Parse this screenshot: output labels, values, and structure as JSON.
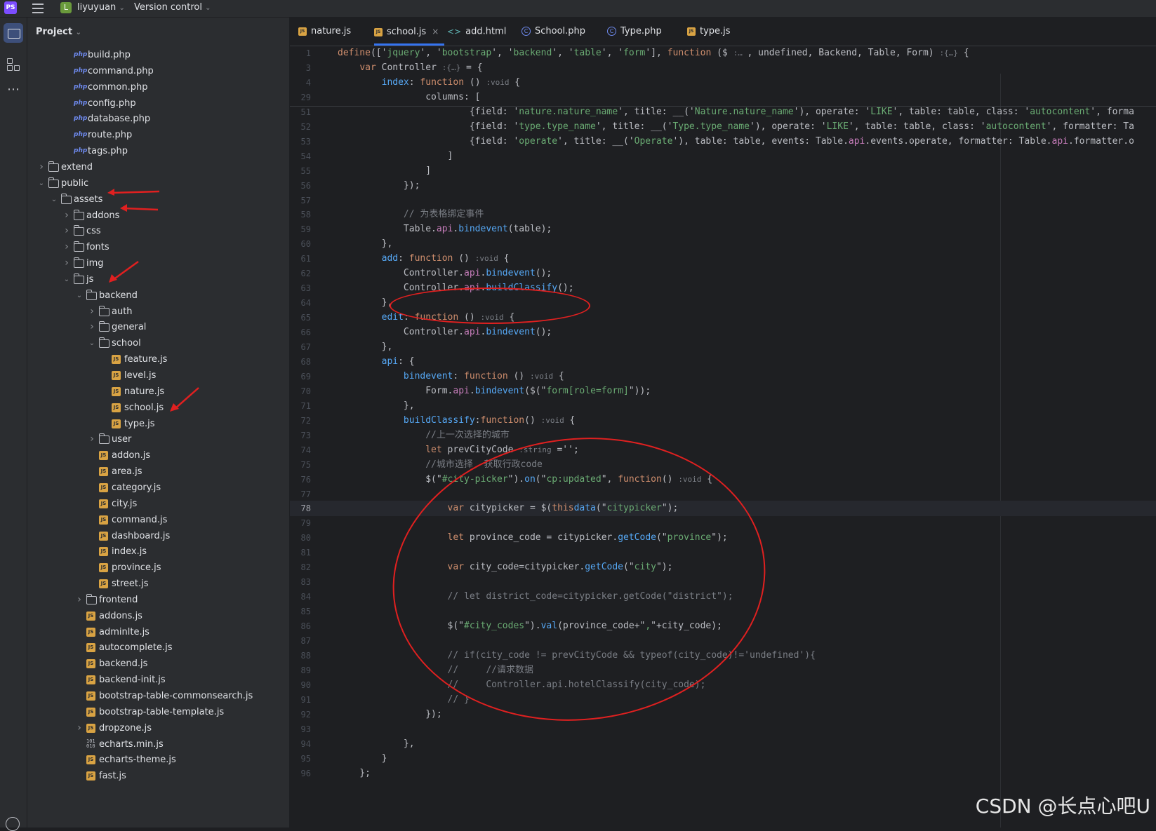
{
  "titlebar": {
    "app_icon": "PS",
    "project_badge": "L",
    "project_name": "liyuyuan",
    "version_control": "Version control"
  },
  "project_panel": {
    "title": "Project"
  },
  "tree": [
    {
      "label": "build.php",
      "type": "php",
      "depth": 3,
      "arrow": ""
    },
    {
      "label": "command.php",
      "type": "php",
      "depth": 3,
      "arrow": ""
    },
    {
      "label": "common.php",
      "type": "php",
      "depth": 3,
      "arrow": ""
    },
    {
      "label": "config.php",
      "type": "php",
      "depth": 3,
      "arrow": ""
    },
    {
      "label": "database.php",
      "type": "php",
      "depth": 3,
      "arrow": ""
    },
    {
      "label": "route.php",
      "type": "php",
      "depth": 3,
      "arrow": ""
    },
    {
      "label": "tags.php",
      "type": "php",
      "depth": 3,
      "arrow": ""
    },
    {
      "label": "extend",
      "type": "folder",
      "depth": 1,
      "arrow": "collapsed"
    },
    {
      "label": "public",
      "type": "folder",
      "depth": 1,
      "arrow": "expanded"
    },
    {
      "label": "assets",
      "type": "folder",
      "depth": 2,
      "arrow": "expanded"
    },
    {
      "label": "addons",
      "type": "folder",
      "depth": 3,
      "arrow": "collapsed"
    },
    {
      "label": "css",
      "type": "folder",
      "depth": 3,
      "arrow": "collapsed"
    },
    {
      "label": "fonts",
      "type": "folder",
      "depth": 3,
      "arrow": "collapsed"
    },
    {
      "label": "img",
      "type": "folder",
      "depth": 3,
      "arrow": "collapsed"
    },
    {
      "label": "js",
      "type": "folder",
      "depth": 3,
      "arrow": "expanded"
    },
    {
      "label": "backend",
      "type": "folder",
      "depth": 4,
      "arrow": "expanded"
    },
    {
      "label": "auth",
      "type": "folder",
      "depth": 5,
      "arrow": "collapsed"
    },
    {
      "label": "general",
      "type": "folder",
      "depth": 5,
      "arrow": "collapsed"
    },
    {
      "label": "school",
      "type": "folder",
      "depth": 5,
      "arrow": "expanded"
    },
    {
      "label": "feature.js",
      "type": "js",
      "depth": 6,
      "arrow": ""
    },
    {
      "label": "level.js",
      "type": "js",
      "depth": 6,
      "arrow": ""
    },
    {
      "label": "nature.js",
      "type": "js",
      "depth": 6,
      "arrow": ""
    },
    {
      "label": "school.js",
      "type": "js",
      "depth": 6,
      "arrow": ""
    },
    {
      "label": "type.js",
      "type": "js",
      "depth": 6,
      "arrow": ""
    },
    {
      "label": "user",
      "type": "folder",
      "depth": 5,
      "arrow": "collapsed"
    },
    {
      "label": "addon.js",
      "type": "js",
      "depth": 5,
      "arrow": ""
    },
    {
      "label": "area.js",
      "type": "js",
      "depth": 5,
      "arrow": ""
    },
    {
      "label": "category.js",
      "type": "js",
      "depth": 5,
      "arrow": ""
    },
    {
      "label": "city.js",
      "type": "js",
      "depth": 5,
      "arrow": ""
    },
    {
      "label": "command.js",
      "type": "js",
      "depth": 5,
      "arrow": ""
    },
    {
      "label": "dashboard.js",
      "type": "js",
      "depth": 5,
      "arrow": ""
    },
    {
      "label": "index.js",
      "type": "js",
      "depth": 5,
      "arrow": ""
    },
    {
      "label": "province.js",
      "type": "js",
      "depth": 5,
      "arrow": ""
    },
    {
      "label": "street.js",
      "type": "js",
      "depth": 5,
      "arrow": ""
    },
    {
      "label": "frontend",
      "type": "folder",
      "depth": 4,
      "arrow": "collapsed"
    },
    {
      "label": "addons.js",
      "type": "js",
      "depth": 4,
      "arrow": ""
    },
    {
      "label": "adminlte.js",
      "type": "js",
      "depth": 4,
      "arrow": ""
    },
    {
      "label": "autocomplete.js",
      "type": "js",
      "depth": 4,
      "arrow": ""
    },
    {
      "label": "backend.js",
      "type": "js",
      "depth": 4,
      "arrow": ""
    },
    {
      "label": "backend-init.js",
      "type": "js",
      "depth": 4,
      "arrow": ""
    },
    {
      "label": "bootstrap-table-commonsearch.js",
      "type": "js",
      "depth": 4,
      "arrow": ""
    },
    {
      "label": "bootstrap-table-template.js",
      "type": "js",
      "depth": 4,
      "arrow": ""
    },
    {
      "label": "dropzone.js",
      "type": "js",
      "depth": 4,
      "arrow": "collapsed"
    },
    {
      "label": "echarts.min.js",
      "type": "bin",
      "depth": 4,
      "arrow": ""
    },
    {
      "label": "echarts-theme.js",
      "type": "js",
      "depth": 4,
      "arrow": ""
    },
    {
      "label": "fast.js",
      "type": "js",
      "depth": 4,
      "arrow": ""
    }
  ],
  "tabs": [
    {
      "label": "nature.js",
      "icon": "js",
      "active": false,
      "closable": false
    },
    {
      "label": "school.js",
      "icon": "js",
      "active": true,
      "closable": true
    },
    {
      "label": "add.html",
      "icon": "html",
      "active": false,
      "closable": false
    },
    {
      "label": "School.php",
      "icon": "php",
      "active": false,
      "closable": false
    },
    {
      "label": "Type.php",
      "icon": "php",
      "active": false,
      "closable": false
    },
    {
      "label": "type.js",
      "icon": "js",
      "active": false,
      "closable": false
    }
  ],
  "code": [
    {
      "n": "1",
      "segs": [
        [
          "kw",
          "define"
        ],
        [
          "",
          "(['"
        ],
        [
          "str",
          "jquery"
        ],
        [
          "",
          "', '"
        ],
        [
          "str",
          "bootstrap"
        ],
        [
          "",
          "', '"
        ],
        [
          "str",
          "backend"
        ],
        [
          "",
          "', '"
        ],
        [
          "str",
          "table"
        ],
        [
          "",
          "', '"
        ],
        [
          "str",
          "form"
        ],
        [
          "",
          "'], "
        ],
        [
          "kw",
          "function"
        ],
        [
          "",
          " ($ "
        ],
        [
          "hint",
          ":… "
        ],
        [
          "",
          ", undefined, Backend, Table, Form) "
        ],
        [
          "hint",
          ":{…}"
        ],
        [
          "",
          " {"
        ]
      ]
    },
    {
      "n": "3",
      "segs": [
        [
          "",
          "    "
        ],
        [
          "kw",
          "var"
        ],
        [
          "",
          " Controller "
        ],
        [
          "hint",
          ":{…}"
        ],
        [
          "",
          " = {"
        ]
      ]
    },
    {
      "n": "4",
      "segs": [
        [
          "",
          "        "
        ],
        [
          "fn",
          "index"
        ],
        [
          "",
          ": "
        ],
        [
          "kw",
          "function"
        ],
        [
          "",
          " () "
        ],
        [
          "hint",
          ":void"
        ],
        [
          "",
          " {"
        ]
      ]
    },
    {
      "n": "29",
      "segs": [
        [
          "",
          "                columns: ["
        ]
      ]
    },
    {
      "n": "51",
      "segs": [
        [
          "",
          "                        {field: '"
        ],
        [
          "str",
          "nature.nature_name"
        ],
        [
          "",
          "', title: __('"
        ],
        [
          "str",
          "Nature.nature_name"
        ],
        [
          "",
          "'), operate: '"
        ],
        [
          "str",
          "LIKE"
        ],
        [
          "",
          "', table: table, class: '"
        ],
        [
          "str",
          "autocontent"
        ],
        [
          "",
          "', forma"
        ]
      ]
    },
    {
      "n": "52",
      "segs": [
        [
          "",
          "                        {field: '"
        ],
        [
          "str",
          "type.type_name"
        ],
        [
          "",
          "', title: __('"
        ],
        [
          "str",
          "Type.type_name"
        ],
        [
          "",
          "'), operate: '"
        ],
        [
          "str",
          "LIKE"
        ],
        [
          "",
          "', table: table, class: '"
        ],
        [
          "str",
          "autocontent"
        ],
        [
          "",
          "', formatter: Ta"
        ]
      ]
    },
    {
      "n": "53",
      "segs": [
        [
          "",
          "                        {field: '"
        ],
        [
          "str",
          "operate"
        ],
        [
          "",
          "', title: __('"
        ],
        [
          "str",
          "Operate"
        ],
        [
          "",
          "'), table: table, events: Table."
        ],
        [
          "prop",
          "api"
        ],
        [
          "",
          ".events.operate, formatter: Table."
        ],
        [
          "prop",
          "api"
        ],
        [
          "",
          ".formatter.o"
        ]
      ]
    },
    {
      "n": "54",
      "segs": [
        [
          "",
          "                    ]"
        ]
      ]
    },
    {
      "n": "55",
      "segs": [
        [
          "",
          "                ]"
        ]
      ]
    },
    {
      "n": "56",
      "segs": [
        [
          "",
          "            });"
        ]
      ]
    },
    {
      "n": "57",
      "segs": [
        [
          "",
          ""
        ]
      ]
    },
    {
      "n": "58",
      "segs": [
        [
          "",
          "            "
        ],
        [
          "cm",
          "// 为表格绑定事件"
        ]
      ]
    },
    {
      "n": "59",
      "segs": [
        [
          "",
          "            Table."
        ],
        [
          "prop",
          "api"
        ],
        [
          "",
          "."
        ],
        [
          "fn",
          "bindevent"
        ],
        [
          "",
          "(table);"
        ]
      ]
    },
    {
      "n": "60",
      "segs": [
        [
          "",
          "        },"
        ]
      ]
    },
    {
      "n": "61",
      "segs": [
        [
          "",
          "        "
        ],
        [
          "fn",
          "add"
        ],
        [
          "",
          ": "
        ],
        [
          "kw",
          "function"
        ],
        [
          "",
          " () "
        ],
        [
          "hint",
          ":void"
        ],
        [
          "",
          " {"
        ]
      ]
    },
    {
      "n": "62",
      "segs": [
        [
          "",
          "            Controller."
        ],
        [
          "prop",
          "api"
        ],
        [
          "",
          "."
        ],
        [
          "fn",
          "bindevent"
        ],
        [
          "",
          "();"
        ]
      ]
    },
    {
      "n": "63",
      "segs": [
        [
          "",
          "            Controller."
        ],
        [
          "prop",
          "api"
        ],
        [
          "",
          "."
        ],
        [
          "fn",
          "buildClassify"
        ],
        [
          "",
          "();"
        ]
      ]
    },
    {
      "n": "64",
      "segs": [
        [
          "",
          "        },"
        ]
      ]
    },
    {
      "n": "65",
      "segs": [
        [
          "",
          "        "
        ],
        [
          "fn",
          "edit"
        ],
        [
          "",
          ": "
        ],
        [
          "kw",
          "function"
        ],
        [
          "",
          " () "
        ],
        [
          "hint",
          ":void"
        ],
        [
          "",
          " {"
        ]
      ]
    },
    {
      "n": "66",
      "segs": [
        [
          "",
          "            Controller."
        ],
        [
          "prop",
          "api"
        ],
        [
          "",
          "."
        ],
        [
          "fn",
          "bindevent"
        ],
        [
          "",
          "();"
        ]
      ]
    },
    {
      "n": "67",
      "segs": [
        [
          "",
          "        },"
        ]
      ]
    },
    {
      "n": "68",
      "segs": [
        [
          "",
          "        "
        ],
        [
          "fn",
          "api"
        ],
        [
          "",
          ": {"
        ]
      ]
    },
    {
      "n": "69",
      "segs": [
        [
          "",
          "            "
        ],
        [
          "fn",
          "bindevent"
        ],
        [
          "",
          ": "
        ],
        [
          "kw",
          "function"
        ],
        [
          "",
          " () "
        ],
        [
          "hint",
          ":void"
        ],
        [
          "",
          " {"
        ]
      ]
    },
    {
      "n": "70",
      "segs": [
        [
          "",
          "                Form."
        ],
        [
          "prop",
          "api"
        ],
        [
          "",
          "."
        ],
        [
          "fn",
          "bindevent"
        ],
        [
          "",
          "($(\""
        ],
        [
          "str",
          "form[role=form]"
        ],
        [
          "",
          "\"));"
        ]
      ]
    },
    {
      "n": "71",
      "segs": [
        [
          "",
          "            },"
        ]
      ]
    },
    {
      "n": "72",
      "segs": [
        [
          "",
          "            "
        ],
        [
          "fn",
          "buildClassify"
        ],
        [
          "",
          ":"
        ],
        [
          "kw",
          "function"
        ],
        [
          "",
          "() "
        ],
        [
          "hint",
          ":void"
        ],
        [
          "",
          " {"
        ]
      ]
    },
    {
      "n": "73",
      "segs": [
        [
          "",
          "                "
        ],
        [
          "cm",
          "//上一次选择的城市"
        ]
      ]
    },
    {
      "n": "74",
      "segs": [
        [
          "",
          "                "
        ],
        [
          "kw",
          "let"
        ],
        [
          "",
          " prevCityCode "
        ],
        [
          "hint",
          ":string"
        ],
        [
          "",
          " ='';"
        ]
      ]
    },
    {
      "n": "75",
      "segs": [
        [
          "",
          "                "
        ],
        [
          "cm",
          "//城市选择  获取行政code"
        ]
      ]
    },
    {
      "n": "76",
      "segs": [
        [
          "",
          "                $(\""
        ],
        [
          "str",
          "#city-picker"
        ],
        [
          "",
          "\")."
        ],
        [
          "fn",
          "on"
        ],
        [
          "",
          "(\""
        ],
        [
          "str",
          "cp:updated"
        ],
        [
          "",
          "\", "
        ],
        [
          "kw",
          "function"
        ],
        [
          "",
          "() "
        ],
        [
          "hint",
          ":void"
        ],
        [
          "",
          " {"
        ]
      ]
    },
    {
      "n": "77",
      "segs": [
        [
          "",
          ""
        ]
      ]
    },
    {
      "n": "78",
      "cur": true,
      "segs": [
        [
          "",
          "                    "
        ],
        [
          "kw",
          "var"
        ],
        [
          "",
          " citypicker = $("
        ],
        [
          "thisk",
          "this"
        ],
        [
          ").",
          ""
        ],
        [
          "fn",
          "data"
        ],
        [
          "",
          "(\""
        ],
        [
          "str",
          "citypicker"
        ],
        [
          "",
          "\");"
        ]
      ]
    },
    {
      "n": "79",
      "segs": [
        [
          "",
          ""
        ]
      ]
    },
    {
      "n": "80",
      "segs": [
        [
          "",
          "                    "
        ],
        [
          "kw",
          "let"
        ],
        [
          "",
          " province_code = citypicker."
        ],
        [
          "fn",
          "getCode"
        ],
        [
          "",
          "(\""
        ],
        [
          "str",
          "province"
        ],
        [
          "",
          "\");"
        ]
      ]
    },
    {
      "n": "81",
      "segs": [
        [
          "",
          ""
        ]
      ]
    },
    {
      "n": "82",
      "segs": [
        [
          "",
          "                    "
        ],
        [
          "kw",
          "var"
        ],
        [
          "",
          " city_code=citypicker."
        ],
        [
          "fn",
          "getCode"
        ],
        [
          "",
          "(\""
        ],
        [
          "str",
          "city"
        ],
        [
          "",
          "\");"
        ]
      ]
    },
    {
      "n": "83",
      "segs": [
        [
          "",
          ""
        ]
      ]
    },
    {
      "n": "84",
      "segs": [
        [
          "",
          "                    "
        ],
        [
          "cm",
          "// let district_code=citypicker.getCode(\"district\");"
        ]
      ]
    },
    {
      "n": "85",
      "segs": [
        [
          "",
          ""
        ]
      ]
    },
    {
      "n": "86",
      "segs": [
        [
          "",
          "                    $(\""
        ],
        [
          "str",
          "#city_codes"
        ],
        [
          "",
          "\")."
        ],
        [
          "fn",
          "val"
        ],
        [
          "",
          "(province_code+\""
        ],
        [
          "str",
          ","
        ],
        [
          "",
          "\"+city_code);"
        ]
      ]
    },
    {
      "n": "87",
      "segs": [
        [
          "",
          ""
        ]
      ]
    },
    {
      "n": "88",
      "segs": [
        [
          "",
          "                    "
        ],
        [
          "cm",
          "// if(city_code != prevCityCode && typeof(city_code)!='undefined'){"
        ]
      ]
    },
    {
      "n": "89",
      "segs": [
        [
          "",
          "                    "
        ],
        [
          "cm",
          "//     //请求数据"
        ]
      ]
    },
    {
      "n": "90",
      "segs": [
        [
          "",
          "                    "
        ],
        [
          "cm",
          "//     Controller.api.hotelClassify(city_code);"
        ]
      ]
    },
    {
      "n": "91",
      "segs": [
        [
          "",
          "                    "
        ],
        [
          "cm",
          "// }"
        ]
      ]
    },
    {
      "n": "92",
      "segs": [
        [
          "",
          "                });"
        ]
      ]
    },
    {
      "n": "93",
      "segs": [
        [
          "",
          ""
        ]
      ]
    },
    {
      "n": "94",
      "segs": [
        [
          "",
          "            },"
        ]
      ]
    },
    {
      "n": "95",
      "segs": [
        [
          "",
          "        }"
        ]
      ]
    },
    {
      "n": "96",
      "segs": [
        [
          "",
          "    };"
        ]
      ]
    }
  ],
  "watermark": "CSDN @长点心吧U"
}
